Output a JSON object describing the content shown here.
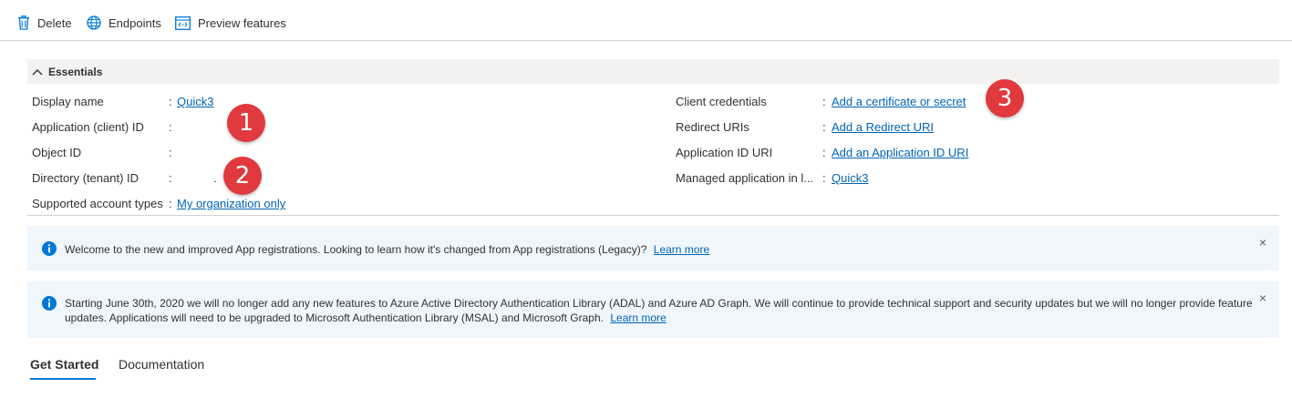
{
  "toolbar": {
    "delete_label": "Delete",
    "endpoints_label": "Endpoints",
    "preview_label": "Preview features"
  },
  "essentials": {
    "title": "Essentials",
    "left": [
      {
        "label": "Display name",
        "value": "Quick3",
        "link": true
      },
      {
        "label": "Application (client) ID",
        "value": "",
        "link": false
      },
      {
        "label": "Object ID",
        "value": "",
        "link": false
      },
      {
        "label": "Directory (tenant) ID",
        "value": ".",
        "link": false
      },
      {
        "label": "Supported account types",
        "value": "My organization only",
        "link": true
      }
    ],
    "right": [
      {
        "label": "Client credentials",
        "value": "Add a certificate or secret",
        "link": true
      },
      {
        "label": "Redirect URIs",
        "value": "Add a Redirect URI",
        "link": true
      },
      {
        "label": "Application ID URI",
        "value": "Add an Application ID URI",
        "link": true
      },
      {
        "label": "Managed application in l...",
        "value": "Quick3",
        "link": true
      }
    ],
    "colon": ":"
  },
  "annotations": [
    "1",
    "2",
    "3"
  ],
  "banners": [
    {
      "text": "Welcome to the new and improved App registrations. Looking to learn how it's changed from App registrations (Legacy)?",
      "link": "Learn more"
    },
    {
      "text_line1": "Starting June 30th, 2020 we will no longer add any new features to Azure Active Directory Authentication Library (ADAL) and Azure AD Graph. We will continue to provide technical support and security updates but we will no longer provide feature",
      "text_line2": "updates. Applications will need to be upgraded to Microsoft Authentication Library (MSAL) and Microsoft Graph.",
      "link": "Learn more"
    }
  ],
  "close_glyph": "×",
  "tabs": [
    {
      "label": "Get Started",
      "active": true
    },
    {
      "label": "Documentation",
      "active": false
    }
  ],
  "colors": {
    "link": "#0064b4",
    "accent": "#0078d4",
    "badge": "#e0393e",
    "banner_bg": "#eff6fc",
    "essentials_bg": "#f3f2f1"
  }
}
